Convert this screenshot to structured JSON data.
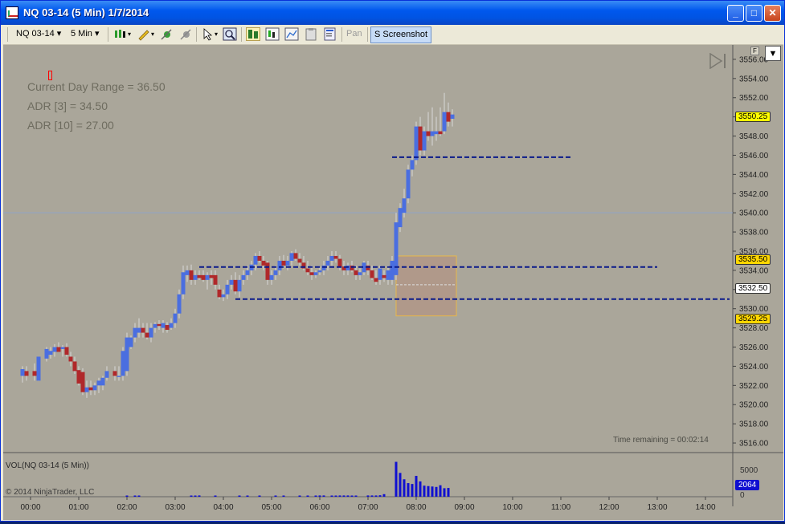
{
  "window": {
    "title": "NQ 03-14 (5 Min)  1/7/2014",
    "minimize": "_",
    "maximize": "□",
    "close": "✕"
  },
  "toolbar": {
    "instrument": "NQ 03-14",
    "period": "5 Min",
    "pan_label": "Pan",
    "screenshot_label": "S Screenshot",
    "icons": [
      "chart-style-icon",
      "drawing-pencil-icon",
      "add-indicator-icon",
      "strategy-icon",
      "pointer-icon",
      "zoom-icon",
      "data-box-icon",
      "bars-icon",
      "line-chart-icon",
      "properties-icon",
      "clipboard-icon"
    ]
  },
  "hud": {
    "current_day_range": "Current Day Range = 36.50",
    "adr3": "ADR [3] = 34.50",
    "adr10": "ADR [10] = 27.00"
  },
  "time_remaining": "Time remaining = 00:02:14",
  "volume_panel": {
    "label": "VOL(NQ 03-14 (5 Min))",
    "axis_5000": "5000",
    "axis_0": "0",
    "current": "2064"
  },
  "copyright": "© 2014 NinjaTrader, LLC",
  "price_tags": {
    "last": {
      "text": "3550.25",
      "color": "#ffff00"
    },
    "upper": {
      "text": "3535.50",
      "color": "#ffd700"
    },
    "mid": {
      "text": "3532.50",
      "color": "#ffffff"
    },
    "lower": {
      "text": "3529.25",
      "color": "#ffd700"
    }
  },
  "panel_button_f": "F",
  "panel_menu": "▼",
  "colors": {
    "background": "#aaa69a",
    "up": "#4a6ee0",
    "down": "#b0282a",
    "wick": "#d8d8d8",
    "levels": "#0b1a8a",
    "volume": "#1010d0"
  },
  "chart_data": {
    "type": "candlestick",
    "price_ticks": [
      "3556.00",
      "3554.00",
      "3552.00",
      "3550.00",
      "3548.00",
      "3546.00",
      "3544.00",
      "3542.00",
      "3540.00",
      "3538.00",
      "3536.00",
      "3534.00",
      "3532.00",
      "3530.00",
      "3528.00",
      "3526.00",
      "3524.00",
      "3522.00",
      "3520.00",
      "3518.00",
      "3516.00"
    ],
    "time_ticks": [
      "00:00",
      "01:00",
      "02:00",
      "03:00",
      "04:00",
      "05:00",
      "06:00",
      "07:00",
      "08:00",
      "09:00",
      "10:00",
      "11:00",
      "12:00",
      "13:00",
      "14:00"
    ],
    "ylim": [
      3515.0,
      3557.5
    ],
    "horizontal_line": 3540.0,
    "levels": [
      {
        "price": 3545.8,
        "from": "07:30",
        "to": "11:15"
      },
      {
        "price": 3534.35,
        "from": "03:30",
        "to": "13:00"
      },
      {
        "price": 3531.0,
        "from": "04:15",
        "to": "14:30"
      }
    ],
    "range_box": {
      "from": "07:35",
      "to": "08:50",
      "high": 3535.5,
      "low": 3529.25,
      "mid": 3532.5
    },
    "candles": [
      {
        "t": "23:50",
        "o": 3523.0,
        "h": 3524.0,
        "l": 3522.3,
        "c": 3523.7
      },
      {
        "t": "23:55",
        "o": 3523.5,
        "h": 3524.0,
        "l": 3522.5,
        "c": 3523.0
      },
      {
        "t": "00:05",
        "o": 3523.5,
        "h": 3524.3,
        "l": 3522.5,
        "c": 3523.0
      },
      {
        "t": "00:10",
        "o": 3522.5,
        "h": 3525.0,
        "l": 3522.5,
        "c": 3525.0
      },
      {
        "t": "00:20",
        "o": 3524.8,
        "h": 3526.0,
        "l": 3524.5,
        "c": 3525.8
      },
      {
        "t": "00:25",
        "o": 3525.2,
        "h": 3526.0,
        "l": 3524.8,
        "c": 3525.6
      },
      {
        "t": "00:30",
        "o": 3525.5,
        "h": 3526.3,
        "l": 3525.0,
        "c": 3526.0
      },
      {
        "t": "00:35",
        "o": 3526.0,
        "h": 3526.5,
        "l": 3525.5,
        "c": 3525.5
      },
      {
        "t": "00:40",
        "o": 3525.8,
        "h": 3526.2,
        "l": 3525.0,
        "c": 3526.0
      },
      {
        "t": "00:45",
        "o": 3526.0,
        "h": 3526.4,
        "l": 3525.0,
        "c": 3525.2
      },
      {
        "t": "00:50",
        "o": 3525.0,
        "h": 3525.5,
        "l": 3524.0,
        "c": 3524.5
      },
      {
        "t": "00:55",
        "o": 3524.5,
        "h": 3525.0,
        "l": 3523.2,
        "c": 3523.5
      },
      {
        "t": "01:00",
        "o": 3523.6,
        "h": 3524.0,
        "l": 3522.0,
        "c": 3522.2
      },
      {
        "t": "01:05",
        "o": 3523.4,
        "h": 3523.8,
        "l": 3521.0,
        "c": 3521.3
      },
      {
        "t": "01:10",
        "o": 3521.3,
        "h": 3522.5,
        "l": 3520.7,
        "c": 3521.8
      },
      {
        "t": "01:15",
        "o": 3521.8,
        "h": 3522.5,
        "l": 3521.0,
        "c": 3521.5
      },
      {
        "t": "01:20",
        "o": 3521.5,
        "h": 3522.3,
        "l": 3521.0,
        "c": 3522.0
      },
      {
        "t": "01:25",
        "o": 3522.0,
        "h": 3522.8,
        "l": 3521.2,
        "c": 3522.5
      },
      {
        "t": "01:30",
        "o": 3522.0,
        "h": 3523.0,
        "l": 3521.5,
        "c": 3522.8
      },
      {
        "t": "01:35",
        "o": 3522.8,
        "h": 3524.0,
        "l": 3522.5,
        "c": 3523.5
      },
      {
        "t": "01:45",
        "o": 3523.5,
        "h": 3524.0,
        "l": 3522.5,
        "c": 3523.0
      },
      {
        "t": "01:50",
        "o": 3523.0,
        "h": 3524.0,
        "l": 3522.5,
        "c": 3523.0
      },
      {
        "t": "01:55",
        "o": 3523.0,
        "h": 3526.0,
        "l": 3522.5,
        "c": 3525.6
      },
      {
        "t": "02:00",
        "o": 3523.5,
        "h": 3527.5,
        "l": 3523.0,
        "c": 3527.0
      },
      {
        "t": "02:05",
        "o": 3526.0,
        "h": 3527.2,
        "l": 3525.8,
        "c": 3527.0
      },
      {
        "t": "02:10",
        "o": 3527.0,
        "h": 3528.5,
        "l": 3526.5,
        "c": 3528.0
      },
      {
        "t": "02:15",
        "o": 3527.5,
        "h": 3529.0,
        "l": 3527.0,
        "c": 3528.0
      },
      {
        "t": "02:20",
        "o": 3528.0,
        "h": 3528.5,
        "l": 3527.0,
        "c": 3527.5
      },
      {
        "t": "02:25",
        "o": 3527.5,
        "h": 3528.5,
        "l": 3526.8,
        "c": 3527.0
      },
      {
        "t": "02:30",
        "o": 3527.0,
        "h": 3528.5,
        "l": 3526.5,
        "c": 3528.0
      },
      {
        "t": "02:35",
        "o": 3528.0,
        "h": 3528.6,
        "l": 3527.5,
        "c": 3528.4
      },
      {
        "t": "02:40",
        "o": 3528.4,
        "h": 3528.8,
        "l": 3527.8,
        "c": 3528.2
      },
      {
        "t": "02:45",
        "o": 3528.0,
        "h": 3528.8,
        "l": 3527.5,
        "c": 3528.5
      },
      {
        "t": "02:50",
        "o": 3528.3,
        "h": 3528.6,
        "l": 3527.5,
        "c": 3527.8
      },
      {
        "t": "02:55",
        "o": 3528.0,
        "h": 3529.0,
        "l": 3527.8,
        "c": 3528.5
      },
      {
        "t": "03:00",
        "o": 3528.5,
        "h": 3530.0,
        "l": 3528.0,
        "c": 3529.5
      },
      {
        "t": "03:05",
        "o": 3529.5,
        "h": 3532.0,
        "l": 3529.0,
        "c": 3531.5
      },
      {
        "t": "03:10",
        "o": 3531.5,
        "h": 3534.5,
        "l": 3531.0,
        "c": 3533.8
      },
      {
        "t": "03:15",
        "o": 3533.5,
        "h": 3534.5,
        "l": 3532.8,
        "c": 3534.0
      },
      {
        "t": "03:20",
        "o": 3534.0,
        "h": 3534.6,
        "l": 3532.5,
        "c": 3533.0
      },
      {
        "t": "03:25",
        "o": 3533.0,
        "h": 3534.0,
        "l": 3532.5,
        "c": 3533.5
      },
      {
        "t": "03:30",
        "o": 3533.5,
        "h": 3534.0,
        "l": 3533.0,
        "c": 3533.2
      },
      {
        "t": "03:35",
        "o": 3533.5,
        "h": 3534.0,
        "l": 3532.8,
        "c": 3533.0
      },
      {
        "t": "03:40",
        "o": 3533.0,
        "h": 3533.8,
        "l": 3532.0,
        "c": 3533.5
      },
      {
        "t": "03:45",
        "o": 3533.5,
        "h": 3534.0,
        "l": 3532.5,
        "c": 3533.2
      },
      {
        "t": "03:50",
        "o": 3533.5,
        "h": 3534.0,
        "l": 3532.0,
        "c": 3532.5
      },
      {
        "t": "03:55",
        "o": 3532.0,
        "h": 3532.5,
        "l": 3531.0,
        "c": 3531.2
      },
      {
        "t": "04:00",
        "o": 3531.2,
        "h": 3532.0,
        "l": 3530.8,
        "c": 3531.5
      },
      {
        "t": "04:05",
        "o": 3531.5,
        "h": 3533.0,
        "l": 3531.0,
        "c": 3532.5
      },
      {
        "t": "04:10",
        "o": 3532.5,
        "h": 3533.5,
        "l": 3532.0,
        "c": 3533.0
      },
      {
        "t": "04:15",
        "o": 3533.0,
        "h": 3533.8,
        "l": 3531.5,
        "c": 3531.8
      },
      {
        "t": "04:20",
        "o": 3531.8,
        "h": 3533.5,
        "l": 3531.2,
        "c": 3533.0
      },
      {
        "t": "04:25",
        "o": 3533.0,
        "h": 3534.0,
        "l": 3532.5,
        "c": 3533.5
      },
      {
        "t": "04:30",
        "o": 3533.5,
        "h": 3534.5,
        "l": 3533.0,
        "c": 3534.0
      },
      {
        "t": "04:35",
        "o": 3534.0,
        "h": 3535.0,
        "l": 3533.5,
        "c": 3534.6
      },
      {
        "t": "04:40",
        "o": 3534.6,
        "h": 3535.8,
        "l": 3534.0,
        "c": 3535.5
      },
      {
        "t": "04:45",
        "o": 3535.5,
        "h": 3536.0,
        "l": 3534.8,
        "c": 3535.0
      },
      {
        "t": "04:50",
        "o": 3535.0,
        "h": 3535.5,
        "l": 3534.0,
        "c": 3534.5
      },
      {
        "t": "04:55",
        "o": 3534.8,
        "h": 3535.0,
        "l": 3532.5,
        "c": 3533.0
      },
      {
        "t": "05:00",
        "o": 3533.0,
        "h": 3534.0,
        "l": 3532.5,
        "c": 3533.5
      },
      {
        "t": "05:05",
        "o": 3533.5,
        "h": 3534.5,
        "l": 3533.0,
        "c": 3534.0
      },
      {
        "t": "05:10",
        "o": 3534.0,
        "h": 3535.5,
        "l": 3533.5,
        "c": 3535.0
      },
      {
        "t": "05:15",
        "o": 3535.0,
        "h": 3535.6,
        "l": 3534.2,
        "c": 3534.5
      },
      {
        "t": "05:20",
        "o": 3534.5,
        "h": 3535.5,
        "l": 3534.0,
        "c": 3535.0
      },
      {
        "t": "05:25",
        "o": 3535.0,
        "h": 3536.0,
        "l": 3534.5,
        "c": 3535.8
      },
      {
        "t": "05:30",
        "o": 3535.8,
        "h": 3536.2,
        "l": 3535.0,
        "c": 3535.2
      },
      {
        "t": "05:35",
        "o": 3535.2,
        "h": 3535.8,
        "l": 3534.5,
        "c": 3534.8
      },
      {
        "t": "05:40",
        "o": 3534.8,
        "h": 3535.5,
        "l": 3534.0,
        "c": 3534.2
      },
      {
        "t": "05:45",
        "o": 3534.2,
        "h": 3535.0,
        "l": 3533.5,
        "c": 3533.8
      },
      {
        "t": "05:50",
        "o": 3533.8,
        "h": 3534.5,
        "l": 3533.0,
        "c": 3533.5
      },
      {
        "t": "05:55",
        "o": 3533.5,
        "h": 3534.0,
        "l": 3533.2,
        "c": 3533.8
      },
      {
        "t": "06:00",
        "o": 3533.8,
        "h": 3534.3,
        "l": 3533.5,
        "c": 3534.0
      }
    ],
    "candles_tail": [
      {
        "t": "06:05",
        "o": 3534.0,
        "h": 3535.0,
        "l": 3533.5,
        "c": 3534.5
      },
      {
        "t": "06:10",
        "o": 3534.5,
        "h": 3535.5,
        "l": 3534.0,
        "c": 3535.0
      },
      {
        "t": "06:15",
        "o": 3535.0,
        "h": 3536.0,
        "l": 3534.5,
        "c": 3535.5
      },
      {
        "t": "06:20",
        "o": 3535.5,
        "h": 3536.0,
        "l": 3534.8,
        "c": 3535.2
      },
      {
        "t": "06:25",
        "o": 3535.2,
        "h": 3535.6,
        "l": 3534.0,
        "c": 3534.4
      },
      {
        "t": "06:30",
        "o": 3534.4,
        "h": 3535.0,
        "l": 3533.5,
        "c": 3534.0
      },
      {
        "t": "06:35",
        "o": 3534.0,
        "h": 3534.8,
        "l": 3533.5,
        "c": 3534.5
      },
      {
        "t": "06:40",
        "o": 3534.5,
        "h": 3535.0,
        "l": 3533.8,
        "c": 3534.0
      },
      {
        "t": "06:45",
        "o": 3534.0,
        "h": 3534.5,
        "l": 3533.0,
        "c": 3533.5
      },
      {
        "t": "06:50",
        "o": 3533.5,
        "h": 3534.2,
        "l": 3533.0,
        "c": 3533.8
      },
      {
        "t": "06:55",
        "o": 3533.8,
        "h": 3535.0,
        "l": 3533.5,
        "c": 3534.8
      },
      {
        "t": "07:00",
        "o": 3534.5,
        "h": 3535.0,
        "l": 3533.5,
        "c": 3534.0
      },
      {
        "t": "07:05",
        "o": 3534.0,
        "h": 3534.5,
        "l": 3533.0,
        "c": 3533.2
      },
      {
        "t": "07:10",
        "o": 3533.2,
        "h": 3534.0,
        "l": 3532.5,
        "c": 3532.8
      },
      {
        "t": "07:15",
        "o": 3533.0,
        "h": 3534.5,
        "l": 3532.5,
        "c": 3534.2
      },
      {
        "t": "07:20",
        "o": 3533.5,
        "h": 3534.0,
        "l": 3532.8,
        "c": 3533.2
      },
      {
        "t": "07:25",
        "o": 3533.0,
        "h": 3534.5,
        "l": 3532.5,
        "c": 3534.0
      },
      {
        "t": "07:30",
        "o": 3533.0,
        "h": 3535.5,
        "l": 3532.5,
        "c": 3535.0
      },
      {
        "t": "07:35",
        "o": 3533.5,
        "h": 3540.0,
        "l": 3533.0,
        "c": 3539.0
      },
      {
        "t": "07:40",
        "o": 3538.5,
        "h": 3541.0,
        "l": 3538.0,
        "c": 3540.5
      },
      {
        "t": "07:45",
        "o": 3540.0,
        "h": 3542.5,
        "l": 3539.5,
        "c": 3541.5
      },
      {
        "t": "07:50",
        "o": 3541.5,
        "h": 3545.0,
        "l": 3541.0,
        "c": 3544.5
      },
      {
        "t": "07:55",
        "o": 3544.5,
        "h": 3546.0,
        "l": 3543.8,
        "c": 3545.5
      },
      {
        "t": "08:00",
        "o": 3545.5,
        "h": 3549.5,
        "l": 3545.0,
        "c": 3549.0
      },
      {
        "t": "08:05",
        "o": 3549.0,
        "h": 3550.0,
        "l": 3546.0,
        "c": 3546.5
      },
      {
        "t": "08:10",
        "o": 3546.5,
        "h": 3549.0,
        "l": 3546.0,
        "c": 3548.5
      },
      {
        "t": "08:15",
        "o": 3548.5,
        "h": 3550.5,
        "l": 3547.5,
        "c": 3548.0
      },
      {
        "t": "08:20",
        "o": 3548.0,
        "h": 3551.0,
        "l": 3547.0,
        "c": 3548.5
      },
      {
        "t": "08:25",
        "o": 3548.2,
        "h": 3550.0,
        "l": 3547.5,
        "c": 3548.5
      },
      {
        "t": "08:30",
        "o": 3548.5,
        "h": 3551.0,
        "l": 3548.0,
        "c": 3548.2
      },
      {
        "t": "08:35",
        "o": 3548.5,
        "h": 3552.5,
        "l": 3548.2,
        "c": 3550.5
      },
      {
        "t": "08:40",
        "o": 3550.5,
        "h": 3551.5,
        "l": 3549.0,
        "c": 3549.5
      },
      {
        "t": "08:45",
        "o": 3549.8,
        "h": 3550.8,
        "l": 3549.0,
        "c": 3550.25
      }
    ],
    "volume": {
      "ylim": [
        0,
        10000
      ],
      "bars": [
        {
          "t": "02:00",
          "v": 150
        },
        {
          "t": "02:10",
          "v": 150
        },
        {
          "t": "02:15",
          "v": 150
        },
        {
          "t": "03:20",
          "v": 150
        },
        {
          "t": "03:25",
          "v": 150
        },
        {
          "t": "03:30",
          "v": 300
        },
        {
          "t": "03:50",
          "v": 200
        },
        {
          "t": "04:20",
          "v": 250
        },
        {
          "t": "04:30",
          "v": 150
        },
        {
          "t": "04:45",
          "v": 150
        },
        {
          "t": "05:05",
          "v": 150
        },
        {
          "t": "05:15",
          "v": 150
        },
        {
          "t": "05:35",
          "v": 150
        },
        {
          "t": "05:45",
          "v": 150
        },
        {
          "t": "05:55",
          "v": 150
        },
        {
          "t": "06:00",
          "v": 300
        },
        {
          "t": "06:05",
          "v": 300
        },
        {
          "t": "06:15",
          "v": 250
        },
        {
          "t": "06:20",
          "v": 250
        },
        {
          "t": "06:25",
          "v": 300
        },
        {
          "t": "06:30",
          "v": 300
        },
        {
          "t": "06:35",
          "v": 300
        },
        {
          "t": "06:40",
          "v": 250
        },
        {
          "t": "06:45",
          "v": 250
        },
        {
          "t": "07:00",
          "v": 300
        },
        {
          "t": "07:05",
          "v": 300
        },
        {
          "t": "07:10",
          "v": 300
        },
        {
          "t": "07:15",
          "v": 350
        },
        {
          "t": "07:20",
          "v": 600
        },
        {
          "t": "07:35",
          "v": 8200
        },
        {
          "t": "07:40",
          "v": 5600
        },
        {
          "t": "07:45",
          "v": 4100
        },
        {
          "t": "07:50",
          "v": 3200
        },
        {
          "t": "07:55",
          "v": 3000
        },
        {
          "t": "08:00",
          "v": 4900
        },
        {
          "t": "08:05",
          "v": 3600
        },
        {
          "t": "08:10",
          "v": 2600
        },
        {
          "t": "08:15",
          "v": 2500
        },
        {
          "t": "08:20",
          "v": 2400
        },
        {
          "t": "08:25",
          "v": 2300
        },
        {
          "t": "08:30",
          "v": 2700
        },
        {
          "t": "08:35",
          "v": 2000
        },
        {
          "t": "08:40",
          "v": 2064
        }
      ]
    }
  }
}
